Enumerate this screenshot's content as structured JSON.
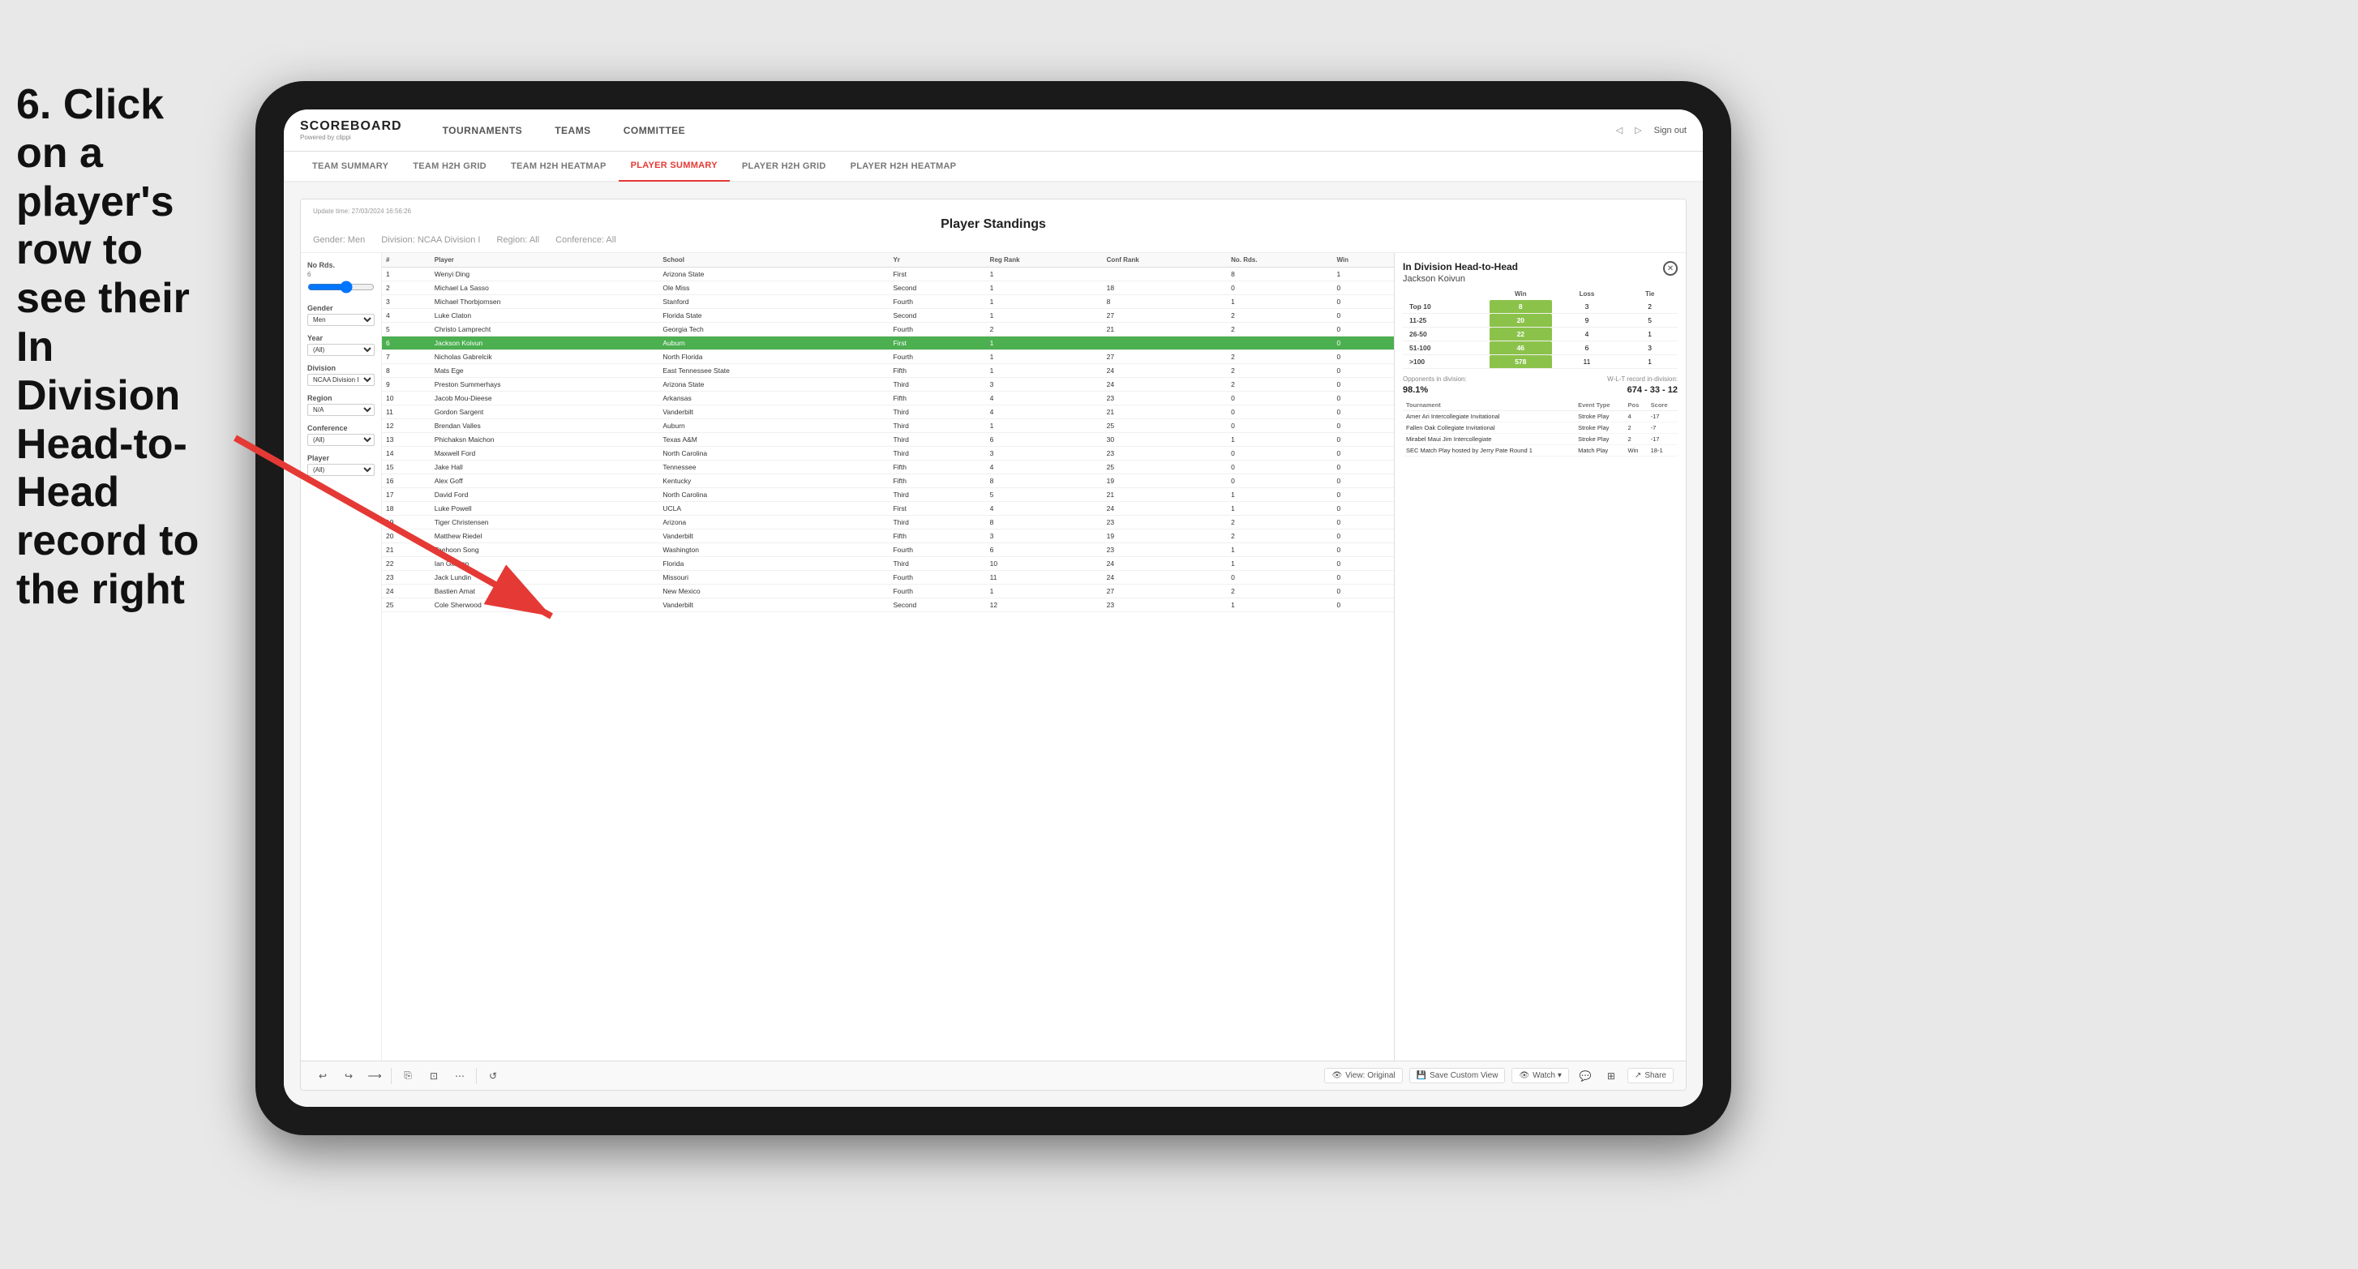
{
  "instruction": {
    "text": "6. Click on a player's row to see their In Division Head-to-Head record to the right"
  },
  "nav": {
    "logo": "SCOREBOARD",
    "logo_sub": "Powered by clippi",
    "items": [
      "TOURNAMENTS",
      "TEAMS",
      "COMMITTEE"
    ],
    "sign_out": "Sign out"
  },
  "subnav": {
    "items": [
      "TEAM SUMMARY",
      "TEAM H2H GRID",
      "TEAM H2H HEATMAP",
      "PLAYER SUMMARY",
      "PLAYER H2H GRID",
      "PLAYER H2H HEATMAP"
    ],
    "active": "PLAYER SUMMARY"
  },
  "panel": {
    "update_time": "Update time: 27/03/2024 16:56:26",
    "title": "Player Standings",
    "filters": {
      "gender": "Gender: Men",
      "division": "Division: NCAA Division I",
      "region": "Region: All",
      "conference": "Conference: All"
    }
  },
  "filter_sidebar": {
    "no_rds": {
      "label": "No Rds.",
      "value": "6",
      "slider_min": 0,
      "slider_max": 10
    },
    "gender": {
      "label": "Gender",
      "value": "Men"
    },
    "year": {
      "label": "Year",
      "value": "(All)"
    },
    "division": {
      "label": "Division",
      "value": "NCAA Division I"
    },
    "region": {
      "label": "Region",
      "value": "N/A"
    },
    "conference": {
      "label": "Conference",
      "value": "(All)"
    },
    "player": {
      "label": "Player",
      "value": "(All)"
    }
  },
  "table": {
    "headers": [
      "#",
      "Player",
      "School",
      "Yr",
      "Reg Rank",
      "Conf Rank",
      "No. Rds.",
      "Win"
    ],
    "rows": [
      {
        "rank": 1,
        "player": "Wenyi Ding",
        "school": "Arizona State",
        "yr": "First",
        "reg": 1,
        "conf": "",
        "rds": 8,
        "win": 1
      },
      {
        "rank": 2,
        "player": "Michael La Sasso",
        "school": "Ole Miss",
        "yr": "Second",
        "reg": 1,
        "conf": 18,
        "rds": 0,
        "win": 0
      },
      {
        "rank": 3,
        "player": "Michael Thorbjornsen",
        "school": "Stanford",
        "yr": "Fourth",
        "reg": 1,
        "conf": 8,
        "rds": 1,
        "win": 0
      },
      {
        "rank": 4,
        "player": "Luke Claton",
        "school": "Florida State",
        "yr": "Second",
        "reg": 1,
        "conf": 27,
        "rds": 2,
        "win": 0
      },
      {
        "rank": 5,
        "player": "Christo Lamprecht",
        "school": "Georgia Tech",
        "yr": "Fourth",
        "reg": 2,
        "conf": 21,
        "rds": 2,
        "win": 0
      },
      {
        "rank": 6,
        "player": "Jackson Koivun",
        "school": "Auburn",
        "yr": "First",
        "reg": 1,
        "conf": "",
        "rds": "",
        "win": 0,
        "highlighted": true
      },
      {
        "rank": 7,
        "player": "Nicholas Gabrelcik",
        "school": "North Florida",
        "yr": "Fourth",
        "reg": 1,
        "conf": 27,
        "rds": 2,
        "win": 0
      },
      {
        "rank": 8,
        "player": "Mats Ege",
        "school": "East Tennessee State",
        "yr": "Fifth",
        "reg": 1,
        "conf": 24,
        "rds": 2,
        "win": 0
      },
      {
        "rank": 9,
        "player": "Preston Summerhays",
        "school": "Arizona State",
        "yr": "Third",
        "reg": 3,
        "conf": 24,
        "rds": 2,
        "win": 0
      },
      {
        "rank": 10,
        "player": "Jacob Mou-Dieese",
        "school": "Arkansas",
        "yr": "Fifth",
        "reg": 4,
        "conf": 23,
        "rds": 0,
        "win": 0
      },
      {
        "rank": 11,
        "player": "Gordon Sargent",
        "school": "Vanderbilt",
        "yr": "Third",
        "reg": 4,
        "conf": 21,
        "rds": 0,
        "win": 0
      },
      {
        "rank": 12,
        "player": "Brendan Valles",
        "school": "Auburn",
        "yr": "Third",
        "reg": 1,
        "conf": 25,
        "rds": 0,
        "win": 0
      },
      {
        "rank": 13,
        "player": "Phichaksn Maichon",
        "school": "Texas A&M",
        "yr": "Third",
        "reg": 6,
        "conf": 30,
        "rds": 1,
        "win": 0
      },
      {
        "rank": 14,
        "player": "Maxwell Ford",
        "school": "North Carolina",
        "yr": "Third",
        "reg": 3,
        "conf": 23,
        "rds": 0,
        "win": 0
      },
      {
        "rank": 15,
        "player": "Jake Hall",
        "school": "Tennessee",
        "yr": "Fifth",
        "reg": 4,
        "conf": 25,
        "rds": 0,
        "win": 0
      },
      {
        "rank": 16,
        "player": "Alex Goff",
        "school": "Kentucky",
        "yr": "Fifth",
        "reg": 8,
        "conf": 19,
        "rds": 0,
        "win": 0
      },
      {
        "rank": 17,
        "player": "David Ford",
        "school": "North Carolina",
        "yr": "Third",
        "reg": 5,
        "conf": 21,
        "rds": 1,
        "win": 0
      },
      {
        "rank": 18,
        "player": "Luke Powell",
        "school": "UCLA",
        "yr": "First",
        "reg": 4,
        "conf": 24,
        "rds": 1,
        "win": 0
      },
      {
        "rank": 19,
        "player": "Tiger Christensen",
        "school": "Arizona",
        "yr": "Third",
        "reg": 8,
        "conf": 23,
        "rds": 2,
        "win": 0
      },
      {
        "rank": 20,
        "player": "Matthew Riedel",
        "school": "Vanderbilt",
        "yr": "Fifth",
        "reg": 3,
        "conf": 19,
        "rds": 2,
        "win": 0
      },
      {
        "rank": 21,
        "player": "Taehoon Song",
        "school": "Washington",
        "yr": "Fourth",
        "reg": 6,
        "conf": 23,
        "rds": 1,
        "win": 0
      },
      {
        "rank": 22,
        "player": "Ian Gilligan",
        "school": "Florida",
        "yr": "Third",
        "reg": 10,
        "conf": 24,
        "rds": 1,
        "win": 0
      },
      {
        "rank": 23,
        "player": "Jack Lundin",
        "school": "Missouri",
        "yr": "Fourth",
        "reg": 11,
        "conf": 24,
        "rds": 0,
        "win": 0
      },
      {
        "rank": 24,
        "player": "Bastien Amat",
        "school": "New Mexico",
        "yr": "Fourth",
        "reg": 1,
        "conf": 27,
        "rds": 2,
        "win": 0
      },
      {
        "rank": 25,
        "player": "Cole Sherwood",
        "school": "Vanderbilt",
        "yr": "Second",
        "reg": 12,
        "conf": 23,
        "rds": 1,
        "win": 0
      }
    ]
  },
  "right_panel": {
    "title": "In Division Head-to-Head",
    "player_name": "Jackson Koivun",
    "h2h_headers": [
      "",
      "Win",
      "Loss",
      "Tie"
    ],
    "h2h_rows": [
      {
        "label": "Top 10",
        "win": 8,
        "loss": 3,
        "tie": 2
      },
      {
        "label": "11-25",
        "win": 20,
        "loss": 9,
        "tie": 5
      },
      {
        "label": "26-50",
        "win": 22,
        "loss": 4,
        "tie": 1
      },
      {
        "label": "51-100",
        "win": 46,
        "loss": 6,
        "tie": 3
      },
      {
        "label": ">100",
        "win": 578,
        "loss": 11,
        "tie": 1
      }
    ],
    "opponents_label": "Opponents in division:",
    "wlt_label": "W-L-T record in-division:",
    "opponents_pct": "98.1%",
    "record": "674 - 33 - 12",
    "tournament_headers": [
      "Tournament",
      "Event Type",
      "Pos",
      "Score"
    ],
    "tournaments": [
      {
        "name": "Amer Ari Intercollegiate Invitational",
        "type": "Stroke Play",
        "pos": 4,
        "score": "-17"
      },
      {
        "name": "Fallen Oak Collegiate Invitational",
        "type": "Stroke Play",
        "pos": 2,
        "score": "-7"
      },
      {
        "name": "Mirabel Maui Jim Intercollegiate",
        "type": "Stroke Play",
        "pos": 2,
        "score": "-17"
      },
      {
        "name": "SEC Match Play hosted by Jerry Pate Round 1",
        "type": "Match Play",
        "pos": "Win",
        "score": "18-1"
      }
    ]
  },
  "toolbar": {
    "undo": "↩",
    "redo": "↪",
    "forward": "⟶",
    "copy": "⎘",
    "paste": "⊡",
    "play": "▶",
    "view_original": "View: Original",
    "save_custom": "Save Custom View",
    "watch": "Watch ▾",
    "share": "Share"
  }
}
